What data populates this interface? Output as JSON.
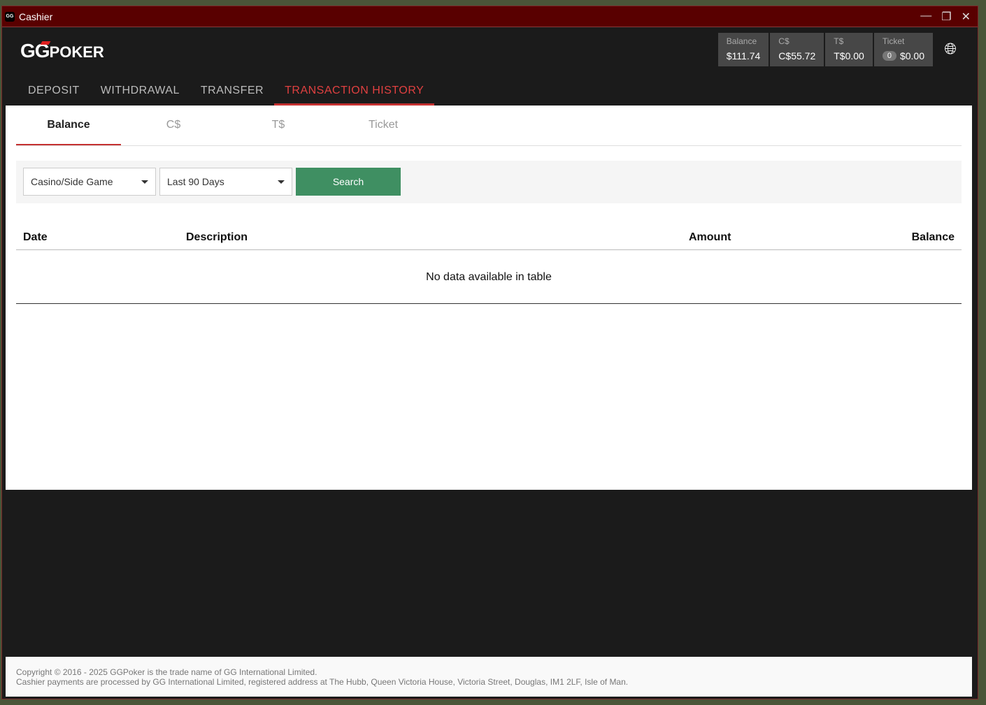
{
  "window": {
    "title": "Cashier",
    "app_icon": "GG"
  },
  "logo": {
    "gg": "GG",
    "poker": "POKER"
  },
  "wallet": [
    {
      "label": "Balance",
      "value": "$111.74"
    },
    {
      "label": "C$",
      "value": "C$55.72"
    },
    {
      "label": "T$",
      "value": "T$0.00"
    },
    {
      "label": "Ticket",
      "count": "0",
      "value": "$0.00"
    }
  ],
  "nav": [
    "DEPOSIT",
    "WITHDRAWAL",
    "TRANSFER",
    "TRANSACTION HISTORY"
  ],
  "subtabs": [
    "Balance",
    "C$",
    "T$",
    "Ticket"
  ],
  "filters": {
    "game": "Casino/Side Game",
    "period": "Last 90 Days",
    "search": "Search"
  },
  "table": {
    "headers": [
      "Date",
      "Description",
      "Amount",
      "Balance"
    ],
    "empty": "No data available in table"
  },
  "footer": [
    "Copyright © 2016 - 2025 GGPoker is the trade name of GG International Limited.",
    "Cashier payments are processed by GG International Limited, registered address at The Hubb, Queen Victoria House, Victoria Street, Douglas, IM1 2LF, Isle of Man."
  ]
}
